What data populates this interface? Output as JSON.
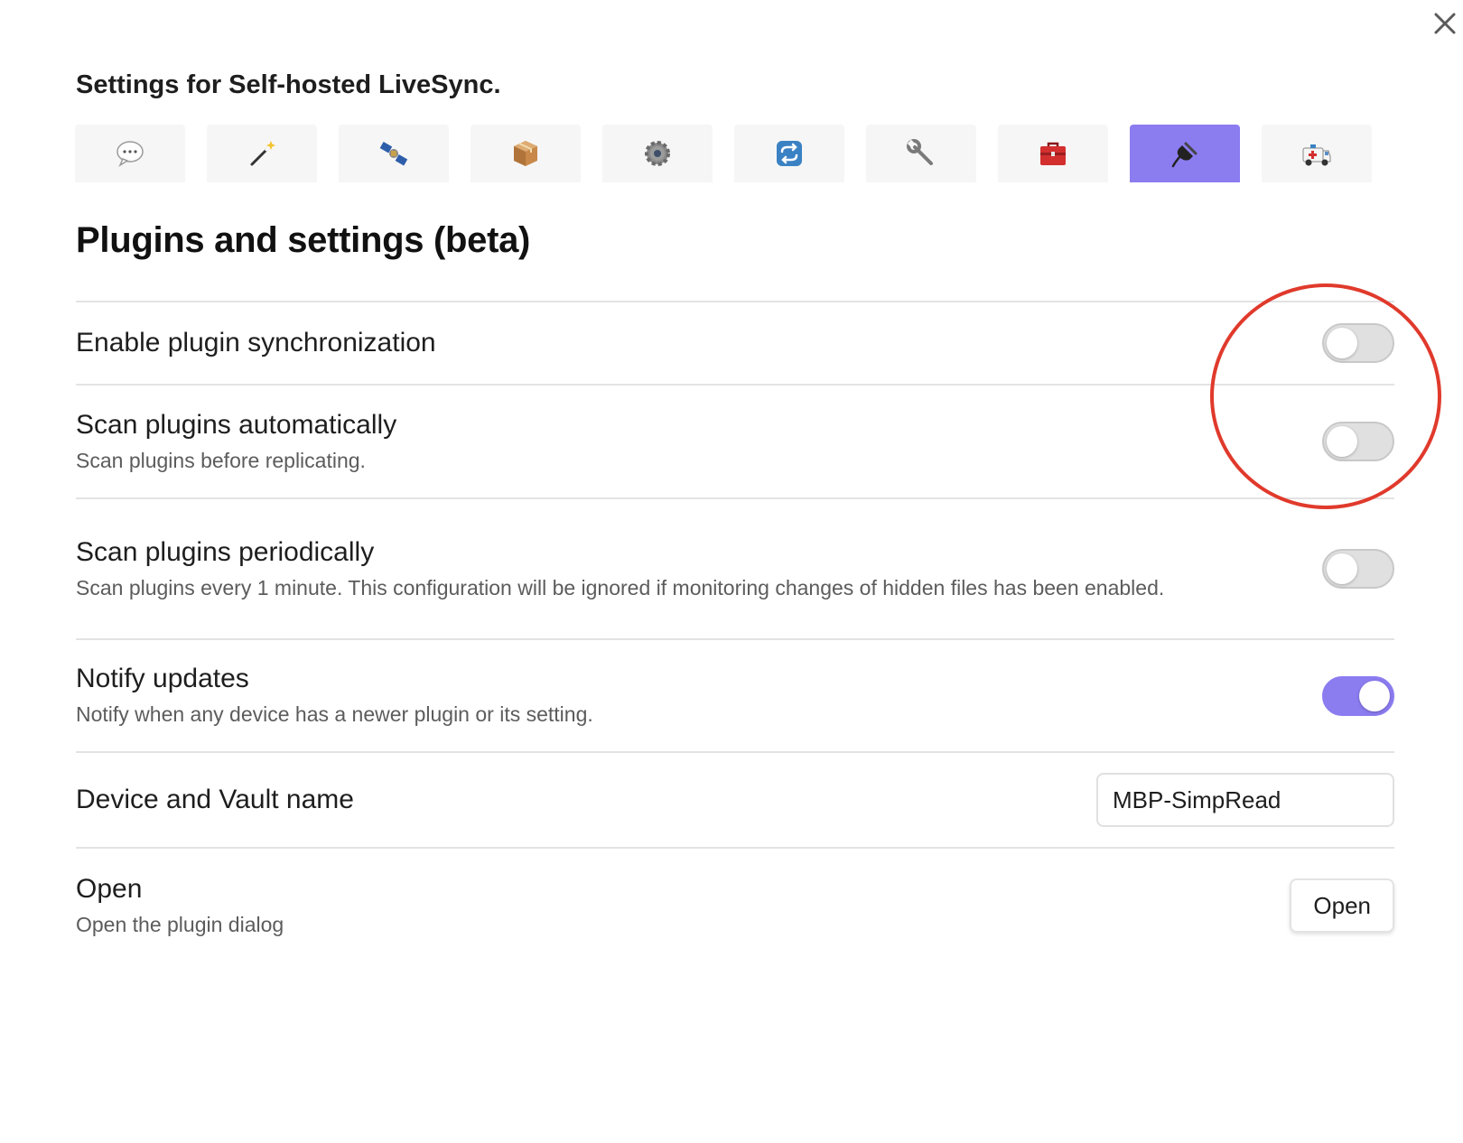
{
  "dialog": {
    "title": "Settings for Self-hosted LiveSync.",
    "close_icon": "close-icon"
  },
  "tabs": [
    {
      "icon": "speech-bubble-icon",
      "active": false
    },
    {
      "icon": "magic-wand-icon",
      "active": false
    },
    {
      "icon": "satellite-icon",
      "active": false
    },
    {
      "icon": "package-icon",
      "active": false
    },
    {
      "icon": "gear-icon",
      "active": false
    },
    {
      "icon": "sync-icon",
      "active": false
    },
    {
      "icon": "wrench-icon",
      "active": false
    },
    {
      "icon": "toolbox-icon",
      "active": false
    },
    {
      "icon": "plug-icon",
      "active": true
    },
    {
      "icon": "ambulance-icon",
      "active": false
    }
  ],
  "section": {
    "title": "Plugins and settings (beta)"
  },
  "settings": {
    "enable_sync": {
      "name": "Enable plugin synchronization",
      "enabled": false
    },
    "scan_auto": {
      "name": "Scan plugins automatically",
      "desc": "Scan plugins before replicating.",
      "enabled": false
    },
    "scan_periodic": {
      "name": "Scan plugins periodically",
      "desc": "Scan plugins every 1 minute. This configuration will be ignored if monitoring changes of hidden files has been enabled.",
      "enabled": false
    },
    "notify_updates": {
      "name": "Notify updates",
      "desc": "Notify when any device has a newer plugin or its setting.",
      "enabled": true
    },
    "device_name": {
      "name": "Device and Vault name",
      "value": "MBP-SimpRead"
    },
    "open": {
      "name": "Open",
      "desc": "Open the plugin dialog",
      "button_label": "Open"
    }
  },
  "colors": {
    "accent": "#8b7cf0",
    "annotation": "#e03a2c"
  }
}
